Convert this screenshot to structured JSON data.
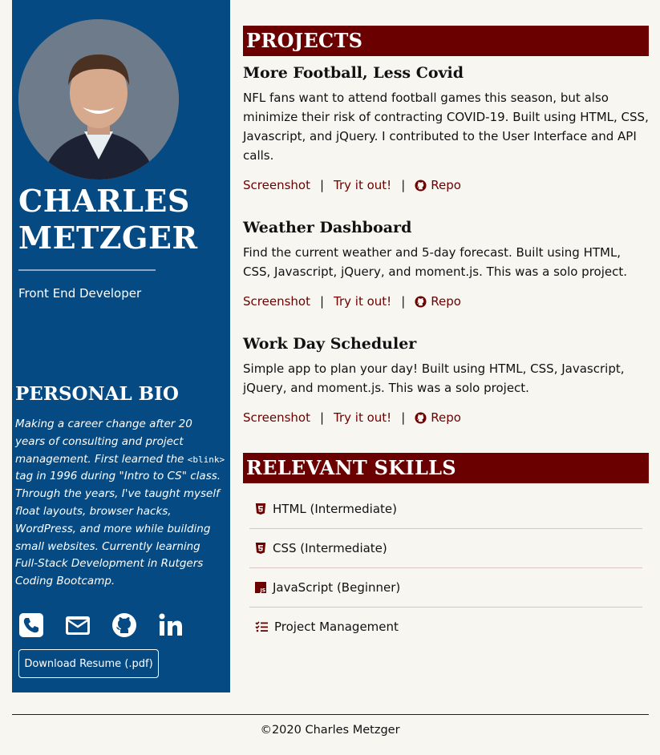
{
  "sidebar": {
    "name_line1": "CHARLES",
    "name_line2": "METZGER",
    "role": "Front End Developer",
    "bio_heading": "PERSONAL BIO",
    "bio_part1": "Making a career change after 20 years of consulting and project management. First learned the ",
    "bio_code": "<blink>",
    "bio_part2": " tag in 1996 during \"Intro to CS\" class. Through the years, I've taught myself float layouts, browser hacks, WordPress, and more while building small websites. Currently learning Full-Stack Development in Rutgers Coding Bootcamp.",
    "social_icons": [
      "phone-icon",
      "email-icon",
      "github-icon",
      "linkedin-icon"
    ],
    "resume_button": "Download Resume (.pdf)"
  },
  "projects": {
    "heading": "PROJECTS",
    "items": [
      {
        "title": "More Football, Less Covid",
        "description": "NFL fans want to attend football games this season, but also minimize their risk of contracting COVID-19. Built using HTML, CSS, Javascript, and jQuery. I contributed to the User Interface and API calls.",
        "screenshot": "Screenshot",
        "try": "Try it out!",
        "repo": "Repo"
      },
      {
        "title": "Weather Dashboard",
        "description": "Find the current weather and 5-day forecast. Built using HTML, CSS, Javascript, jQuery, and moment.js. This was a solo project.",
        "screenshot": "Screenshot",
        "try": "Try it out!",
        "repo": "Repo"
      },
      {
        "title": "Work Day Scheduler",
        "description": "Simple app to plan your day! Built using HTML, CSS, Javascript, jQuery, and moment.js. This was a solo project.",
        "screenshot": "Screenshot",
        "try": "Try it out!",
        "repo": "Repo"
      }
    ],
    "separator": "|"
  },
  "skills": {
    "heading": "RELEVANT SKILLS",
    "items": [
      {
        "icon": "html5-icon",
        "label": "HTML (Intermediate)"
      },
      {
        "icon": "css3-icon",
        "label": "CSS (Intermediate)"
      },
      {
        "icon": "javascript-icon",
        "label": "JavaScript (Beginner)"
      },
      {
        "icon": "task-list-icon",
        "label": "Project Management"
      }
    ]
  },
  "footer": {
    "text": "©2020 Charles Metzger"
  },
  "colors": {
    "sidebar": "#054a82",
    "accent": "#6b0000",
    "background": "#f8f6f1"
  }
}
